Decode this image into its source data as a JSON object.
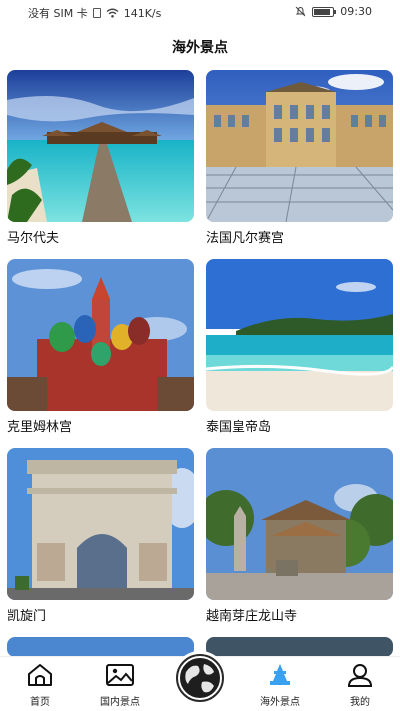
{
  "status_bar": {
    "carrier": "没有 SIM 卡",
    "speed": "141K/s",
    "time": "09:30"
  },
  "page_title": "海外景点",
  "places": [
    {
      "name": "马尔代夫"
    },
    {
      "name": "法国凡尔赛宫"
    },
    {
      "name": "克里姆林宫"
    },
    {
      "name": "泰国皇帝岛"
    },
    {
      "name": "凯旋门"
    },
    {
      "name": "越南芽庄龙山寺"
    }
  ],
  "nav": {
    "home": "首页",
    "domestic": "国内景点",
    "overseas": "海外景点",
    "mine": "我的"
  },
  "colors": {
    "active_tab": "#3aa0f0"
  }
}
